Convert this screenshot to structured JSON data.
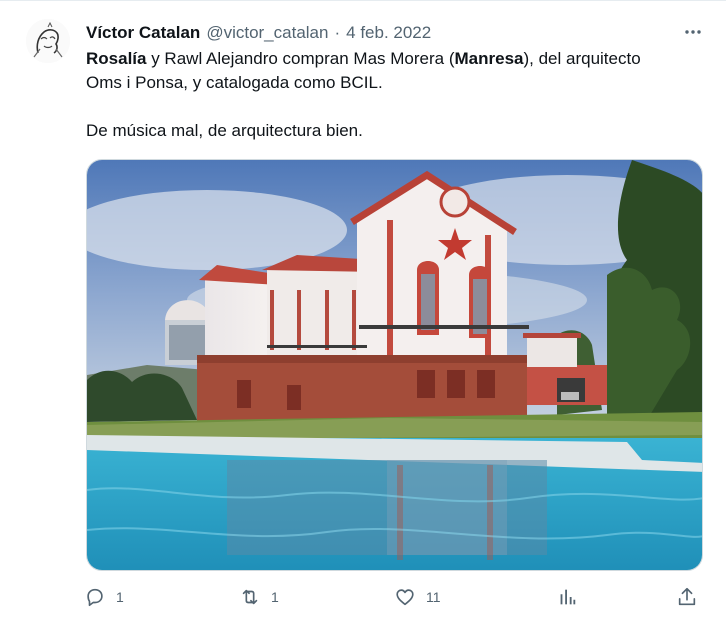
{
  "tweet": {
    "author_name": "Víctor Catalan",
    "handle": "@victor_catalan",
    "separator": "·",
    "date": "4 feb. 2022",
    "text_line1_bold_1": "Rosalía",
    "text_line1_part_2": " y Rawl Alejandro compran Mas Morera (",
    "text_line1_bold_3": "Manresa",
    "text_line1_part_4": "), del arquitecto",
    "text_line2": "Oms i Ponsa, y catalogada como BCIL.",
    "text_line3": "De música mal, de arquitectura bien."
  },
  "actions": {
    "reply_count": "1",
    "retweet_count": "1",
    "like_count": "11"
  },
  "icons": {
    "more": "more-dots-icon",
    "reply": "reply-icon",
    "retweet": "retweet-icon",
    "like": "heart-icon",
    "views": "analytics-icon",
    "share": "share-icon"
  },
  "colors": {
    "text_primary": "#0f1419",
    "text_secondary": "#536471",
    "border": "#cfd9de"
  }
}
